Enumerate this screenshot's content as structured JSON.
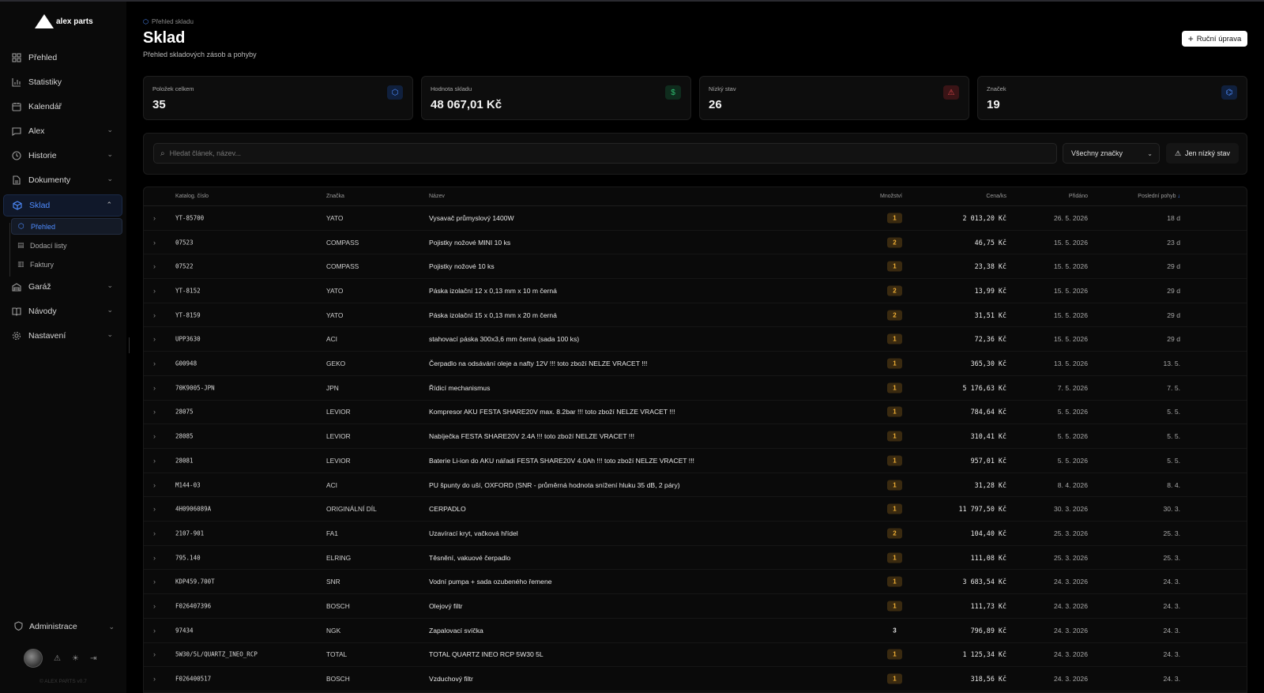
{
  "app": {
    "logo_text": "alex parts",
    "copyright": "© ALEX PARTS v0.7"
  },
  "sidebar": {
    "items": [
      {
        "label": "Přehled",
        "icon": "dashboard-icon"
      },
      {
        "label": "Statistiky",
        "icon": "bar-chart-icon"
      },
      {
        "label": "Kalendář",
        "icon": "calendar-icon"
      },
      {
        "label": "Alex",
        "icon": "chat-icon"
      },
      {
        "label": "Historie",
        "icon": "history-icon"
      },
      {
        "label": "Dokumenty",
        "icon": "document-icon"
      },
      {
        "label": "Sklad",
        "icon": "box-icon"
      },
      {
        "label": "Garáž",
        "icon": "garage-icon"
      },
      {
        "label": "Návody",
        "icon": "book-icon"
      },
      {
        "label": "Nastavení",
        "icon": "gear-icon"
      }
    ],
    "sklad_sub": [
      {
        "label": "Přehled",
        "icon": "box-icon"
      },
      {
        "label": "Dodací listy",
        "icon": "document-icon"
      },
      {
        "label": "Faktury",
        "icon": "receipt-icon"
      }
    ],
    "admin_label": "Administrace"
  },
  "header": {
    "breadcrumb": "Přehled skladu",
    "title": "Sklad",
    "subtitle": "Přehled skladových zásob a pohyby",
    "manual_button": "Ruční úprava"
  },
  "stats": [
    {
      "label": "Položek celkem",
      "value": "35",
      "icon": "box-icon",
      "color": "#4e8cff"
    },
    {
      "label": "Hodnota skladu",
      "value": "48 067,01 Kč",
      "icon": "dollar-icon",
      "color": "#2fbf71"
    },
    {
      "label": "Nízký stav",
      "value": "26",
      "icon": "warning-icon",
      "color": "#e5484d"
    },
    {
      "label": "Značek",
      "value": "19",
      "icon": "tag-icon",
      "color": "#4e8cff"
    }
  ],
  "filters": {
    "search_placeholder": "Hledat článek, název...",
    "brand_select": "Všechny značky",
    "low_stock_button": "Jen nízký stav"
  },
  "table": {
    "columns": {
      "catalog": "Katalog. číslo",
      "brand": "Značka",
      "name": "Název",
      "qty": "Množství",
      "price": "Cena/ks",
      "added": "Přidáno",
      "last": "Poslední pohyb"
    },
    "rows": [
      {
        "cat": "YT-85700",
        "brand": "YATO",
        "name": "Vysavač průmyslový 1400W",
        "qty": "1",
        "price": "2 013,20 Kč",
        "added": "26. 5. 2026",
        "last": "18 d",
        "low": true
      },
      {
        "cat": "07523",
        "brand": "COMPASS",
        "name": "Pojistky nožové MINI 10 ks",
        "qty": "2",
        "price": "46,75 Kč",
        "added": "15. 5. 2026",
        "last": "23 d",
        "low": true
      },
      {
        "cat": "07522",
        "brand": "COMPASS",
        "name": "Pojistky nožové 10 ks",
        "qty": "1",
        "price": "23,38 Kč",
        "added": "15. 5. 2026",
        "last": "29 d",
        "low": true
      },
      {
        "cat": "YT-8152",
        "brand": "YATO",
        "name": "Páska izolační 12 x 0,13 mm x 10 m černá",
        "qty": "2",
        "price": "13,99 Kč",
        "added": "15. 5. 2026",
        "last": "29 d",
        "low": true
      },
      {
        "cat": "YT-8159",
        "brand": "YATO",
        "name": "Páska izolační 15 x 0,13 mm x 20 m černá",
        "qty": "2",
        "price": "31,51 Kč",
        "added": "15. 5. 2026",
        "last": "29 d",
        "low": true
      },
      {
        "cat": "UPP3630",
        "brand": "ACI",
        "name": "stahovací páska 300x3,6 mm černá (sada 100 ks)",
        "qty": "1",
        "price": "72,36 Kč",
        "added": "15. 5. 2026",
        "last": "29 d",
        "low": true
      },
      {
        "cat": "G00948",
        "brand": "GEKO",
        "name": "Čerpadlo na odsávání oleje a nafty 12V !!! toto zboží NELZE VRACET !!!",
        "qty": "1",
        "price": "365,30 Kč",
        "added": "13. 5. 2026",
        "last": "13. 5.",
        "low": true
      },
      {
        "cat": "70K9005-JPN",
        "brand": "JPN",
        "name": "Řídicí mechanismus",
        "qty": "1",
        "price": "5 176,63 Kč",
        "added": "7. 5. 2026",
        "last": "7. 5.",
        "low": true
      },
      {
        "cat": "28075",
        "brand": "LEVIOR",
        "name": "Kompresor AKU FESTA SHARE20V max. 8.2bar !!! toto zboží NELZE VRACET !!!",
        "qty": "1",
        "price": "784,64 Kč",
        "added": "5. 5. 2026",
        "last": "5. 5.",
        "low": true
      },
      {
        "cat": "28085",
        "brand": "LEVIOR",
        "name": "Nabíječka FESTA SHARE20V 2.4A !!! toto zboží NELZE VRACET !!!",
        "qty": "1",
        "price": "310,41 Kč",
        "added": "5. 5. 2026",
        "last": "5. 5.",
        "low": true
      },
      {
        "cat": "28081",
        "brand": "LEVIOR",
        "name": "Baterie Li-ion do AKU nářadí FESTA SHARE20V 4.0Ah !!! toto zboží NELZE VRACET !!!",
        "qty": "1",
        "price": "957,01 Kč",
        "added": "5. 5. 2026",
        "last": "5. 5.",
        "low": true
      },
      {
        "cat": "M144-03",
        "brand": "ACI",
        "name": "PU špunty do uší, OXFORD (SNR - průměrná hodnota snížení hluku 35 dB, 2 páry)",
        "qty": "1",
        "price": "31,28 Kč",
        "added": "8. 4. 2026",
        "last": "8. 4.",
        "low": true
      },
      {
        "cat": "4H0906089A",
        "brand": "ORIGINÁLNÍ DÍL",
        "name": "CERPADLO",
        "qty": "1",
        "price": "11 797,50 Kč",
        "added": "30. 3. 2026",
        "last": "30. 3.",
        "low": true
      },
      {
        "cat": "2107-901",
        "brand": "FA1",
        "name": "Uzavírací kryt, vačková hřídel",
        "qty": "2",
        "price": "104,40 Kč",
        "added": "25. 3. 2026",
        "last": "25. 3.",
        "low": true
      },
      {
        "cat": "795.140",
        "brand": "ELRING",
        "name": "Těsnění, vakuové čerpadlo",
        "qty": "1",
        "price": "111,08 Kč",
        "added": "25. 3. 2026",
        "last": "25. 3.",
        "low": true
      },
      {
        "cat": "KDP459.700T",
        "brand": "SNR",
        "name": "Vodní pumpa + sada ozubeného řemene",
        "qty": "1",
        "price": "3 683,54 Kč",
        "added": "24. 3. 2026",
        "last": "24. 3.",
        "low": true
      },
      {
        "cat": "F026407396",
        "brand": "BOSCH",
        "name": "Olejový filtr",
        "qty": "1",
        "price": "111,73 Kč",
        "added": "24. 3. 2026",
        "last": "24. 3.",
        "low": true
      },
      {
        "cat": "97434",
        "brand": "NGK",
        "name": "Zapalovací svíčka",
        "qty": "3",
        "price": "796,89 Kč",
        "added": "24. 3. 2026",
        "last": "24. 3.",
        "low": false
      },
      {
        "cat": "5W30/5L/QUARTZ_INEO_RCP",
        "brand": "TOTAL",
        "name": "TOTAL QUARTZ INEO RCP 5W30 5L",
        "qty": "1",
        "price": "1 125,34 Kč",
        "added": "24. 3. 2026",
        "last": "24. 3.",
        "low": true
      },
      {
        "cat": "F026400517",
        "brand": "BOSCH",
        "name": "Vzduchový filtr",
        "qty": "1",
        "price": "318,56 Kč",
        "added": "24. 3. 2026",
        "last": "24. 3.",
        "low": true
      }
    ]
  }
}
